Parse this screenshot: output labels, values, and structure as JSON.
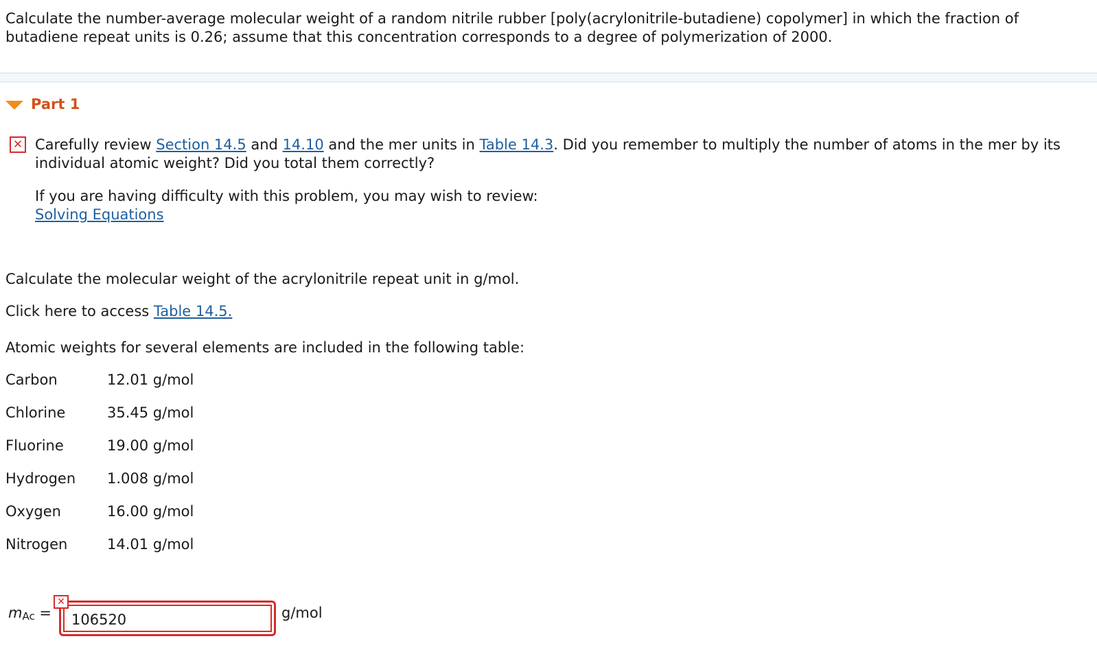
{
  "question": "Calculate the number-average molecular weight of a random nitrile rubber [poly(acrylonitrile-butadiene) copolymer] in which the fraction of butadiene repeat units is 0.26; assume that this concentration corresponds to a degree of polymerization of 2000.",
  "part": {
    "title": "Part 1"
  },
  "feedback": {
    "icon": "x-mark-icon",
    "text_1": "Carefully review ",
    "link_1": "Section 14.5",
    "text_2": " and ",
    "link_2": "14.10",
    "text_3": " and the mer units in ",
    "link_3": "Table 14.3",
    "text_4": ". Did you remember to multiply the number of atoms in the mer by its individual atomic weight? Did you total them correctly?",
    "review_text": "If you are having difficulty with this problem, you may wish to review:",
    "review_link": "Solving Equations"
  },
  "prompt": "Calculate the molecular weight of the acrylonitrile repeat unit in g/mol.",
  "access": {
    "text": "Click here to access ",
    "link": "Table 14.5."
  },
  "table_intro": "Atomic weights for several elements are included in the following table:",
  "atomic_weights": [
    {
      "element": "Carbon",
      "weight": "12.01 g/mol"
    },
    {
      "element": "Chlorine",
      "weight": "35.45 g/mol"
    },
    {
      "element": "Fluorine",
      "weight": "19.00 g/mol"
    },
    {
      "element": "Hydrogen",
      "weight": "1.008 g/mol"
    },
    {
      "element": "Oxygen",
      "weight": "16.00 g/mol"
    },
    {
      "element": "Nitrogen",
      "weight": "14.01 g/mol"
    }
  ],
  "answer": {
    "var_symbol": "m",
    "var_subscript": "Ac",
    "equals": "=",
    "value": "106520",
    "unit": "g/mol",
    "status": "incorrect",
    "status_color": "#d62b2b"
  }
}
